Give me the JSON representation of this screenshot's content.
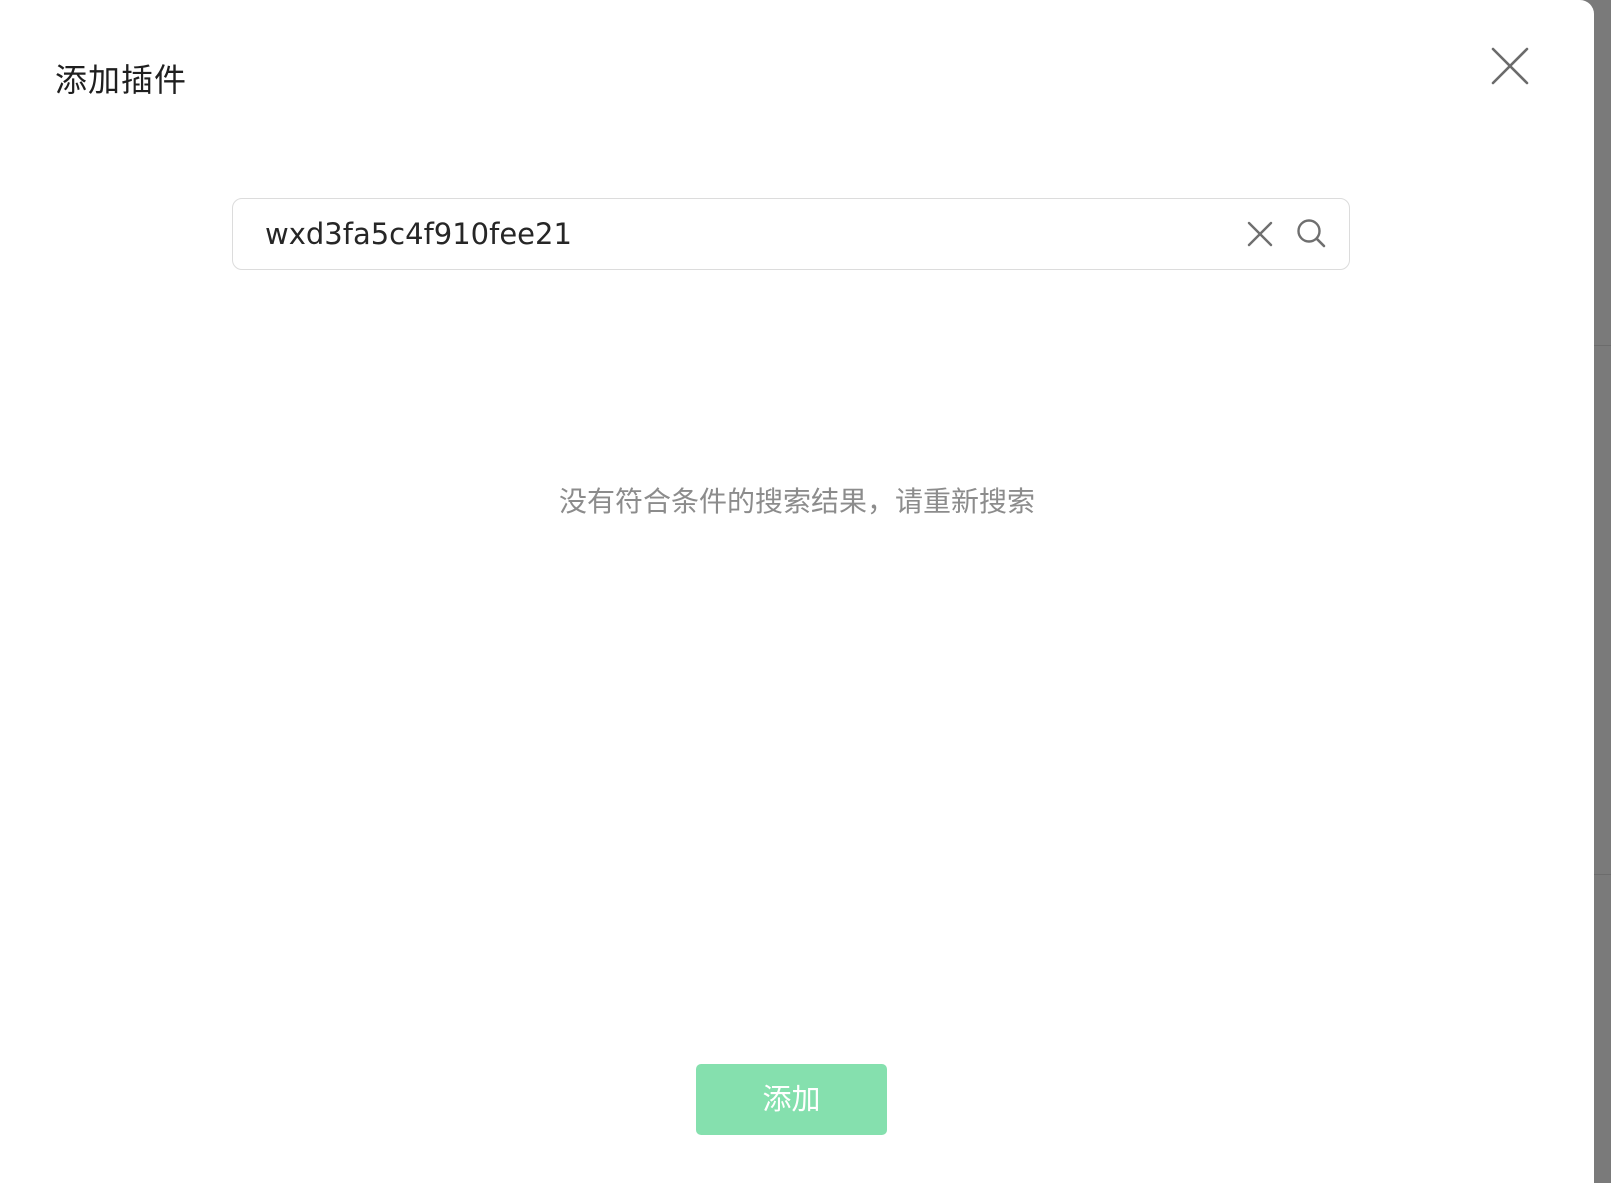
{
  "dialog": {
    "title": "添加插件",
    "close_icon": "close-icon"
  },
  "search": {
    "value": "wxd3fa5c4f910fee21",
    "placeholder": "",
    "clear_icon": "clear-icon",
    "search_icon": "search-icon"
  },
  "results": {
    "empty_message": "没有符合条件的搜索结果，请重新搜索"
  },
  "footer": {
    "add_label": "添加"
  },
  "colors": {
    "primary_disabled": "#85e0ae",
    "text_primary": "#1f1f1f",
    "text_secondary": "#8c8c8c",
    "border": "#dcdcdc",
    "backdrop": "#7a7a7a"
  }
}
